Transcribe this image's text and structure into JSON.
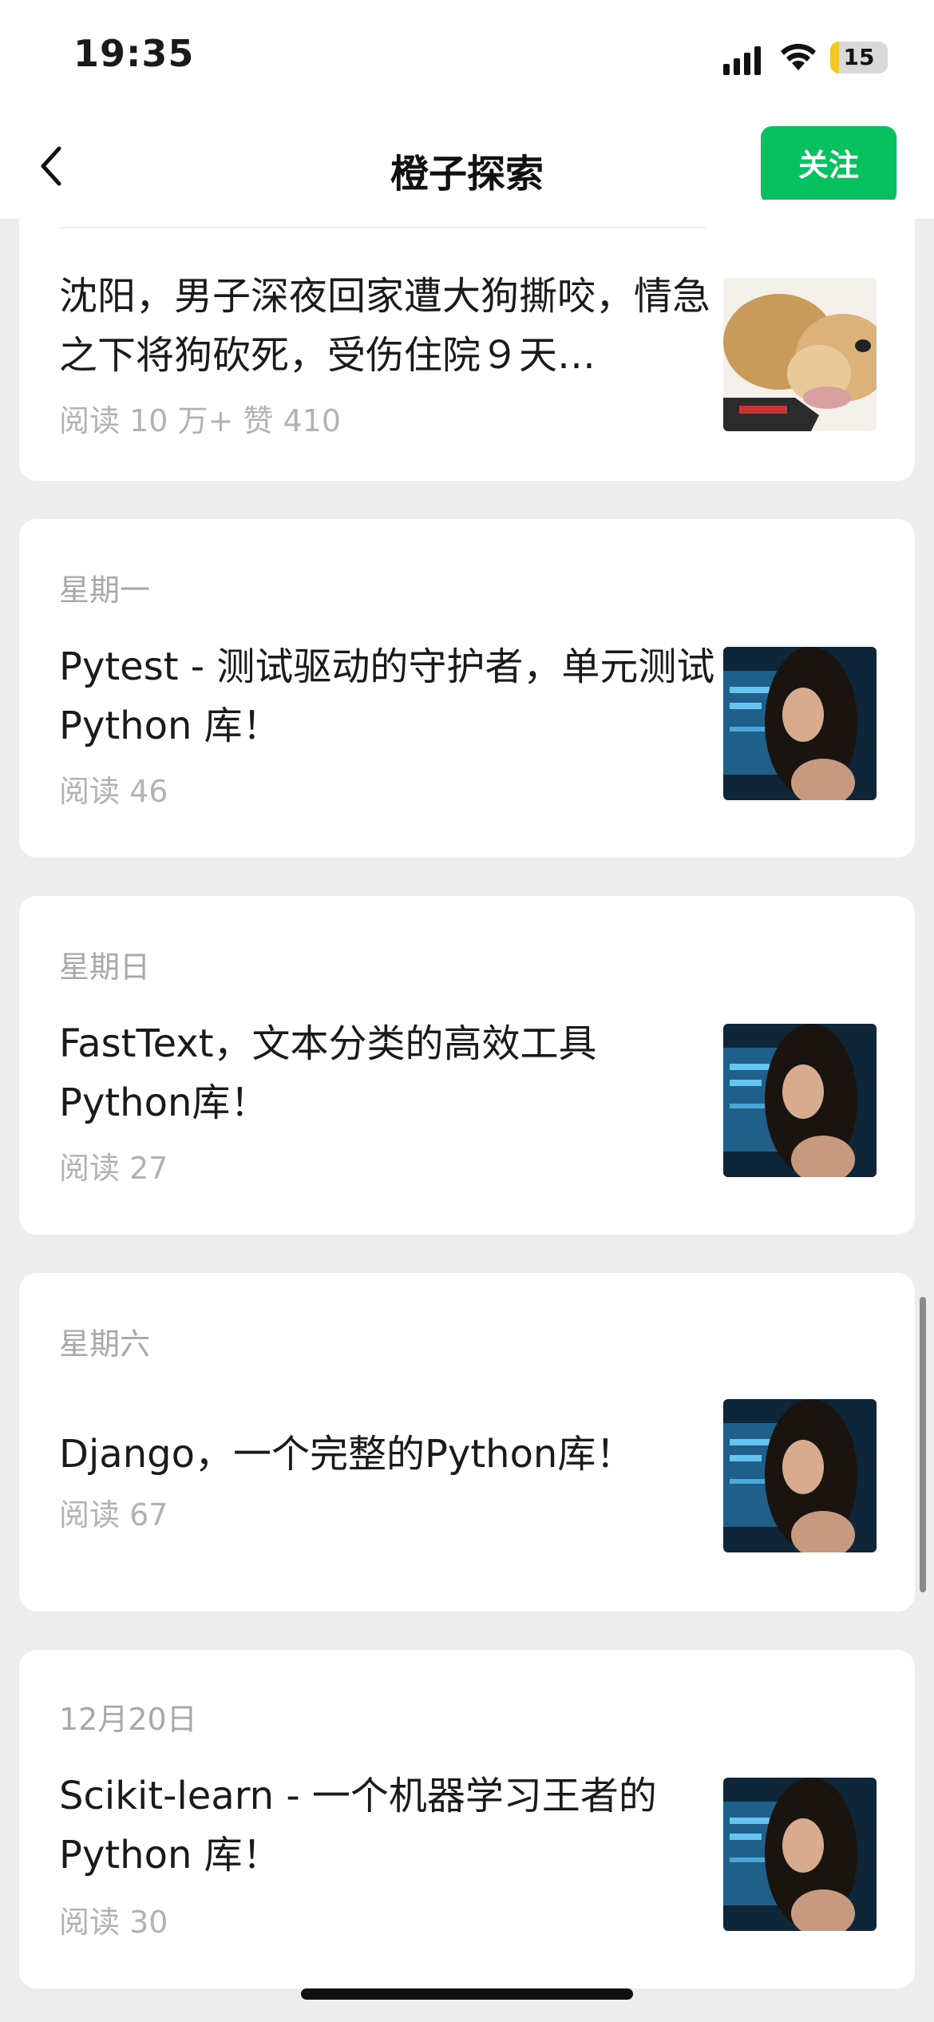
{
  "status_bar": {
    "time": "19:35",
    "battery": "15",
    "battery_level": 0.15
  },
  "nav": {
    "back_icon": "chevron-left-icon",
    "title": "橙子探索",
    "follow_label": "关注"
  },
  "articles": [
    {
      "date": "",
      "title": "沈阳，男子深夜回家遭大狗撕咬，情急之下将狗砍死，受伤住院９天…",
      "meta": "阅读 10 万+  赞 410",
      "thumb": "dog-photo"
    },
    {
      "date": "星期一",
      "title": "Pytest - 测试驱动的守护者，单元测试 Python 库！",
      "meta": "阅读 46",
      "thumb": "portrait-photo"
    },
    {
      "date": "星期日",
      "title": "FastText，文本分类的高效工具 Python库！",
      "meta": "阅读 27",
      "thumb": "portrait-photo"
    },
    {
      "date": "星期六",
      "title": "Django，一个完整的Python库！",
      "meta": "阅读 67",
      "thumb": "portrait-photo"
    },
    {
      "date": "12月20日",
      "title": "Scikit-learn - 一个机器学习王者的 Python 库！",
      "meta": "阅读 30",
      "thumb": "portrait-photo"
    }
  ]
}
